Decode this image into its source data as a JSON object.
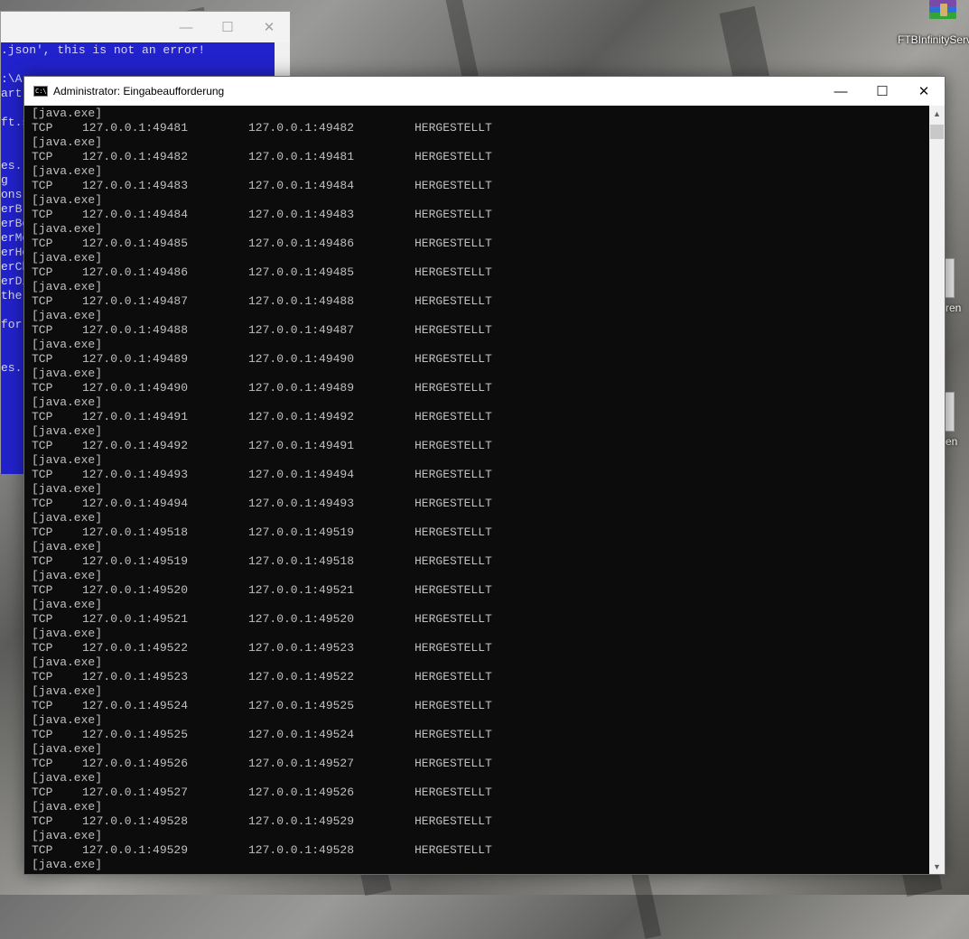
{
  "background_window": {
    "lines": [
      ".json', this is not an error!",
      "",
      ":\\A",
      "art",
      "",
      "ft.s",
      "",
      "",
      "es.",
      "g",
      "ons",
      "erBr",
      "erBe",
      "erMe",
      "erHo",
      "erCh",
      "erDi",
      "the",
      "",
      "for",
      "",
      "",
      "es."
    ]
  },
  "desktop": {
    "icon_label": "FTBInfinityServ",
    "side_labels": [
      "ren",
      "en"
    ]
  },
  "window": {
    "title": "Administrator: Eingabeaufforderung",
    "minimize": "—",
    "maximize": "☐",
    "close": "✕"
  },
  "console": {
    "header_line": "[java.exe]",
    "rows": [
      {
        "proto": "TCP",
        "local": "127.0.0.1:49481",
        "remote": "127.0.0.1:49482",
        "state": "HERGESTELLT",
        "process": "[java.exe]"
      },
      {
        "proto": "TCP",
        "local": "127.0.0.1:49482",
        "remote": "127.0.0.1:49481",
        "state": "HERGESTELLT",
        "process": "[java.exe]"
      },
      {
        "proto": "TCP",
        "local": "127.0.0.1:49483",
        "remote": "127.0.0.1:49484",
        "state": "HERGESTELLT",
        "process": "[java.exe]"
      },
      {
        "proto": "TCP",
        "local": "127.0.0.1:49484",
        "remote": "127.0.0.1:49483",
        "state": "HERGESTELLT",
        "process": "[java.exe]"
      },
      {
        "proto": "TCP",
        "local": "127.0.0.1:49485",
        "remote": "127.0.0.1:49486",
        "state": "HERGESTELLT",
        "process": "[java.exe]"
      },
      {
        "proto": "TCP",
        "local": "127.0.0.1:49486",
        "remote": "127.0.0.1:49485",
        "state": "HERGESTELLT",
        "process": "[java.exe]"
      },
      {
        "proto": "TCP",
        "local": "127.0.0.1:49487",
        "remote": "127.0.0.1:49488",
        "state": "HERGESTELLT",
        "process": "[java.exe]"
      },
      {
        "proto": "TCP",
        "local": "127.0.0.1:49488",
        "remote": "127.0.0.1:49487",
        "state": "HERGESTELLT",
        "process": "[java.exe]"
      },
      {
        "proto": "TCP",
        "local": "127.0.0.1:49489",
        "remote": "127.0.0.1:49490",
        "state": "HERGESTELLT",
        "process": "[java.exe]"
      },
      {
        "proto": "TCP",
        "local": "127.0.0.1:49490",
        "remote": "127.0.0.1:49489",
        "state": "HERGESTELLT",
        "process": "[java.exe]"
      },
      {
        "proto": "TCP",
        "local": "127.0.0.1:49491",
        "remote": "127.0.0.1:49492",
        "state": "HERGESTELLT",
        "process": "[java.exe]"
      },
      {
        "proto": "TCP",
        "local": "127.0.0.1:49492",
        "remote": "127.0.0.1:49491",
        "state": "HERGESTELLT",
        "process": "[java.exe]"
      },
      {
        "proto": "TCP",
        "local": "127.0.0.1:49493",
        "remote": "127.0.0.1:49494",
        "state": "HERGESTELLT",
        "process": "[java.exe]"
      },
      {
        "proto": "TCP",
        "local": "127.0.0.1:49494",
        "remote": "127.0.0.1:49493",
        "state": "HERGESTELLT",
        "process": "[java.exe]"
      },
      {
        "proto": "TCP",
        "local": "127.0.0.1:49518",
        "remote": "127.0.0.1:49519",
        "state": "HERGESTELLT",
        "process": "[java.exe]"
      },
      {
        "proto": "TCP",
        "local": "127.0.0.1:49519",
        "remote": "127.0.0.1:49518",
        "state": "HERGESTELLT",
        "process": "[java.exe]"
      },
      {
        "proto": "TCP",
        "local": "127.0.0.1:49520",
        "remote": "127.0.0.1:49521",
        "state": "HERGESTELLT",
        "process": "[java.exe]"
      },
      {
        "proto": "TCP",
        "local": "127.0.0.1:49521",
        "remote": "127.0.0.1:49520",
        "state": "HERGESTELLT",
        "process": "[java.exe]"
      },
      {
        "proto": "TCP",
        "local": "127.0.0.1:49522",
        "remote": "127.0.0.1:49523",
        "state": "HERGESTELLT",
        "process": "[java.exe]"
      },
      {
        "proto": "TCP",
        "local": "127.0.0.1:49523",
        "remote": "127.0.0.1:49522",
        "state": "HERGESTELLT",
        "process": "[java.exe]"
      },
      {
        "proto": "TCP",
        "local": "127.0.0.1:49524",
        "remote": "127.0.0.1:49525",
        "state": "HERGESTELLT",
        "process": "[java.exe]"
      },
      {
        "proto": "TCP",
        "local": "127.0.0.1:49525",
        "remote": "127.0.0.1:49524",
        "state": "HERGESTELLT",
        "process": "[java.exe]"
      },
      {
        "proto": "TCP",
        "local": "127.0.0.1:49526",
        "remote": "127.0.0.1:49527",
        "state": "HERGESTELLT",
        "process": "[java.exe]"
      },
      {
        "proto": "TCP",
        "local": "127.0.0.1:49527",
        "remote": "127.0.0.1:49526",
        "state": "HERGESTELLT",
        "process": "[java.exe]"
      },
      {
        "proto": "TCP",
        "local": "127.0.0.1:49528",
        "remote": "127.0.0.1:49529",
        "state": "HERGESTELLT",
        "process": "[java.exe]"
      },
      {
        "proto": "TCP",
        "local": "127.0.0.1:49529",
        "remote": "127.0.0.1:49528",
        "state": "HERGESTELLT",
        "process": "[java.exe]"
      }
    ]
  },
  "scrollbar": {
    "up": "▲",
    "down": "▼"
  },
  "colors": {
    "console_bg": "#0c0c0c",
    "console_text": "#c0c0c0",
    "bg_console_bg": "#2222cc"
  }
}
